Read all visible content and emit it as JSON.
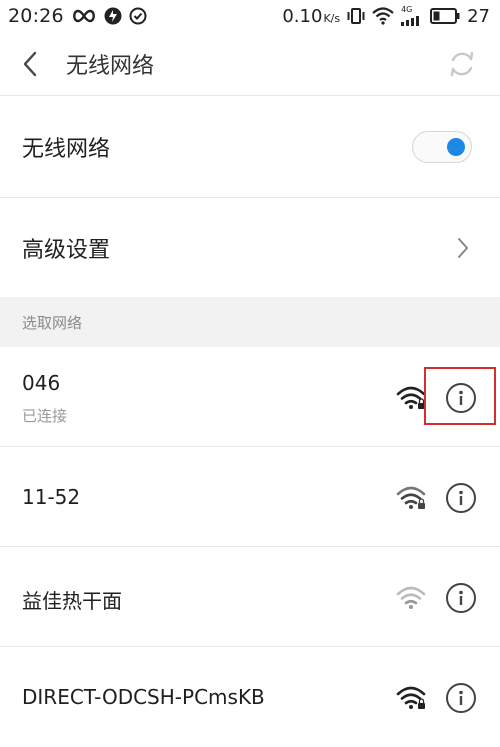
{
  "status_bar": {
    "time": "20:26",
    "speed": "0.10",
    "speed_unit": "K/s",
    "network_type": "4G",
    "battery": "27",
    "icons": [
      "infinity-icon",
      "notification-icon",
      "check-circle-icon",
      "vibrate-icon",
      "wifi-icon",
      "signal-icon",
      "battery-icon"
    ]
  },
  "app_bar": {
    "title": "无线网络"
  },
  "settings": {
    "wifi_label": "无线网络",
    "wifi_enabled": true,
    "advanced_label": "高级设置"
  },
  "section": {
    "title": "选取网络"
  },
  "networks": [
    {
      "name": "046",
      "status": "已连接",
      "secured": true,
      "signal": "full"
    },
    {
      "name": "11-52",
      "status": "",
      "secured": true,
      "signal": "full"
    },
    {
      "name": "益佳热干面",
      "status": "",
      "secured": false,
      "signal": "weak"
    },
    {
      "name": "DIRECT-ODCSH-PCmsKB",
      "status": "",
      "secured": true,
      "signal": "full"
    }
  ],
  "colors": {
    "accent": "#1e88e5",
    "highlight": "#d32f2f",
    "section_bg": "#f2f2f2"
  }
}
